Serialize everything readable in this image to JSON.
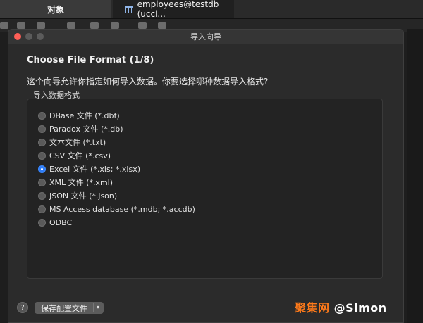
{
  "tabs": [
    {
      "label": "对象"
    },
    {
      "label": "employees@testdb (uccl..."
    }
  ],
  "dialog": {
    "title": "导入向导",
    "heading": "Choose File Format (1/8)",
    "description": "这个向导允许你指定如何导入数据。你要选择哪种数据导入格式?",
    "group_label": "导入数据格式",
    "options": [
      {
        "label": "DBase 文件 (*.dbf)",
        "selected": false
      },
      {
        "label": "Paradox 文件 (*.db)",
        "selected": false
      },
      {
        "label": "文本文件 (*.txt)",
        "selected": false
      },
      {
        "label": "CSV 文件 (*.csv)",
        "selected": false
      },
      {
        "label": "Excel 文件 (*.xls; *.xlsx)",
        "selected": true
      },
      {
        "label": "XML 文件 (*.xml)",
        "selected": false
      },
      {
        "label": "JSON 文件 (*.json)",
        "selected": false
      },
      {
        "label": "MS Access database (*.mdb; *.accdb)",
        "selected": false
      },
      {
        "label": "ODBC",
        "selected": false
      }
    ],
    "help_label": "?",
    "save_config_label": "保存配置文件"
  },
  "watermark": {
    "logo": "聚集网",
    "handle": "@Simon"
  },
  "colors": {
    "accent": "#2f7cf6",
    "close": "#ff5f57"
  }
}
